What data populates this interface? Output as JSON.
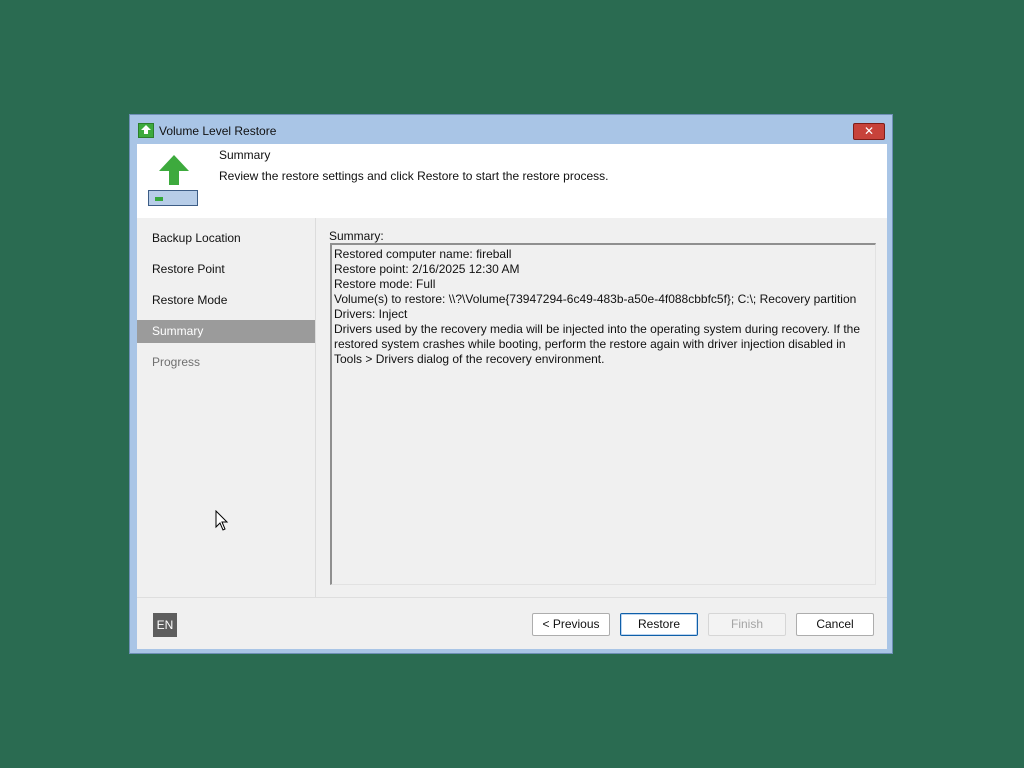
{
  "window": {
    "title": "Volume Level Restore",
    "close_glyph": "✕"
  },
  "header": {
    "title": "Summary",
    "description": "Review the restore settings and click Restore to start the restore process.",
    "icon": "restore-arrow-drive-icon"
  },
  "nav": {
    "items": [
      {
        "label": "Backup Location",
        "state": "normal"
      },
      {
        "label": "Restore Point",
        "state": "normal"
      },
      {
        "label": "Restore Mode",
        "state": "normal"
      },
      {
        "label": "Summary",
        "state": "selected"
      },
      {
        "label": "Progress",
        "state": "disabled"
      }
    ]
  },
  "summary": {
    "label": "Summary:",
    "text": "Restored computer name: fireball\nRestore point: 2/16/2025 12:30 AM\nRestore mode: Full\nVolume(s) to restore: \\\\?\\Volume{73947294-6c49-483b-a50e-4f088cbbfc5f}; C:\\; Recovery partition\nDrivers: Inject\nDrivers used by the recovery media will be injected into the operating system during recovery. If the restored system crashes while booting, perform the restore again with driver injection disabled in Tools > Drivers dialog of the recovery environment."
  },
  "footer": {
    "language": "EN",
    "previous": "< Previous",
    "restore": "Restore",
    "finish": "Finish",
    "cancel": "Cancel"
  },
  "colors": {
    "desktop": "#2a6b51",
    "title_bar": "#a9c5e6",
    "selected_nav": "#9b9b9b",
    "close_button": "#c7423a",
    "accent_green": "#36a83c"
  }
}
